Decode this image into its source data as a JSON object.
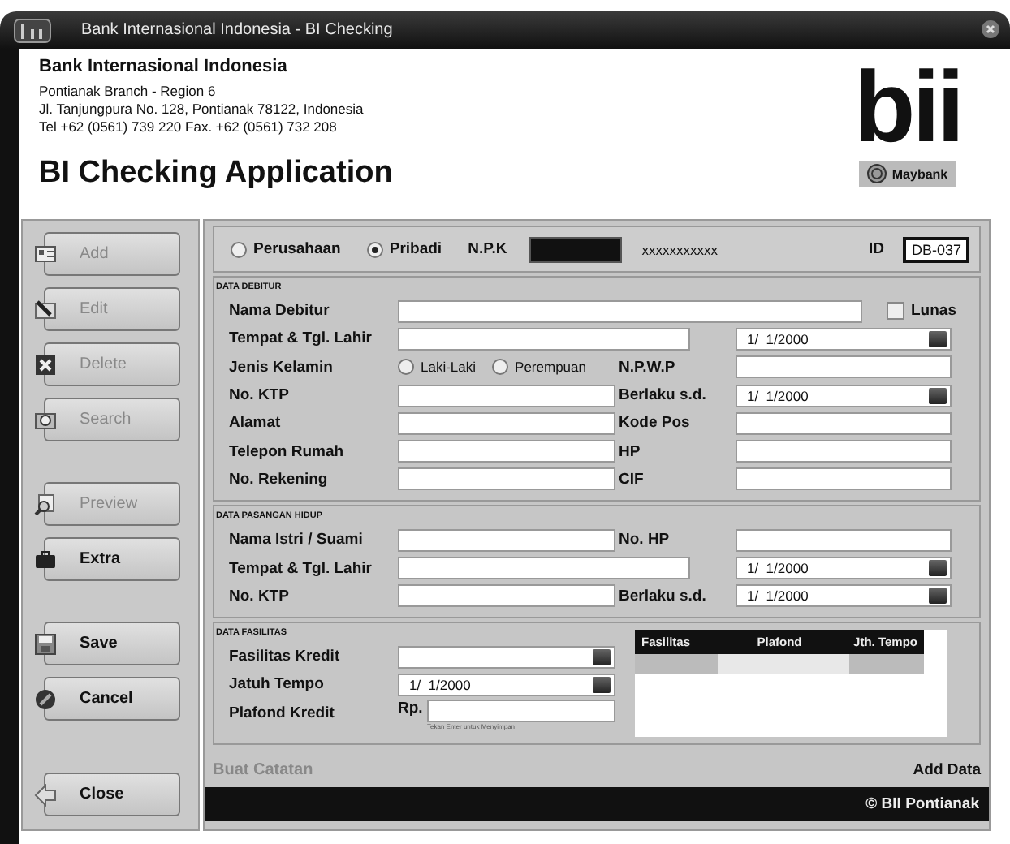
{
  "window": {
    "title": "Bank Internasional Indonesia - BI Checking"
  },
  "header": {
    "company": "Bank Internasional Indonesia",
    "lines": [
      "Pontianak Branch - Region 6",
      "Jl. Tanjungpura No. 128, Pontianak 78122, Indonesia",
      "Tel +62 (0561) 739 220 Fax. +62 (0561) 732 208"
    ],
    "app_title": "BI Checking Application"
  },
  "logo": {
    "text": "bii",
    "tagline": "Maybank"
  },
  "sidebar": {
    "groups": [
      [
        {
          "label": "Add",
          "disabled": true
        },
        {
          "label": "Edit",
          "disabled": true
        },
        {
          "label": "Delete",
          "disabled": true
        },
        {
          "label": "Search",
          "disabled": true
        }
      ],
      [
        {
          "label": "Preview",
          "disabled": true
        },
        {
          "label": "Extra",
          "disabled": false
        }
      ],
      [
        {
          "label": "Save",
          "disabled": false
        },
        {
          "label": "Cancel",
          "disabled": false
        }
      ],
      [
        {
          "label": "Close",
          "disabled": false
        }
      ]
    ]
  },
  "customer_type": [
    {
      "label": "Perusahaan",
      "selected": false
    },
    {
      "label": "Pribadi",
      "selected": true
    }
  ],
  "npk": {
    "label": "N.P.K",
    "masked": "xxxxxxxxxxx"
  },
  "id": {
    "label": "ID",
    "value": "DB-037"
  },
  "sections": [
    {
      "title": "DATA DEBITUR",
      "rows": [
        {
          "kind": "wide_check",
          "label": "Nama Debitur",
          "check": {
            "label": "Lunas",
            "checked": false
          }
        },
        {
          "kind": "long_date",
          "label": "Tempat & Tgl. Lahir",
          "date": "1/  1/2000"
        },
        {
          "kind": "radio_pair",
          "label": "Jenis Kelamin",
          "radios": [
            {
              "label": "Laki-Laki",
              "selected": false
            },
            {
              "label": "Perempuan",
              "selected": false
            }
          ],
          "label2": "N.P.W.P"
        },
        {
          "kind": "pair",
          "label": "No. KTP",
          "label2": "Berlaku s.d.",
          "date2": "1/  1/2000"
        },
        {
          "kind": "pair",
          "label": "Alamat",
          "label2": "Kode Pos"
        },
        {
          "kind": "pair",
          "label": "Telepon Rumah",
          "label2": "HP"
        },
        {
          "kind": "pair",
          "label": "No. Rekening",
          "label2": "CIF"
        }
      ]
    },
    {
      "title": "DATA PASANGAN HIDUP",
      "rows": [
        {
          "kind": "pair",
          "label": "Nama Istri / Suami",
          "label2": "No. HP"
        },
        {
          "kind": "long_date",
          "label": "Tempat & Tgl. Lahir",
          "date": "1/  1/2000"
        },
        {
          "kind": "pair",
          "label": "No. KTP",
          "label2": "Berlaku s.d.",
          "date2": "1/  1/2000"
        }
      ]
    }
  ],
  "facility": {
    "title": "DATA FASILITAS",
    "rows": [
      {
        "kind": "combo",
        "label": "Fasilitas Kredit"
      },
      {
        "kind": "date",
        "label": "Jatuh Tempo",
        "value": "1/  1/2000"
      },
      {
        "kind": "money",
        "label": "Plafond Kredit",
        "prefix": "Rp.",
        "hint": "Tekan Enter untuk Menyimpan"
      }
    ],
    "table": {
      "columns": [
        "Fasilitas",
        "Plafond",
        "Jth. Tempo"
      ]
    }
  },
  "footer": {
    "note_link": "Buat Catatan",
    "add_link": "Add Data"
  },
  "status_bar": {
    "text": "© BII Pontianak"
  }
}
